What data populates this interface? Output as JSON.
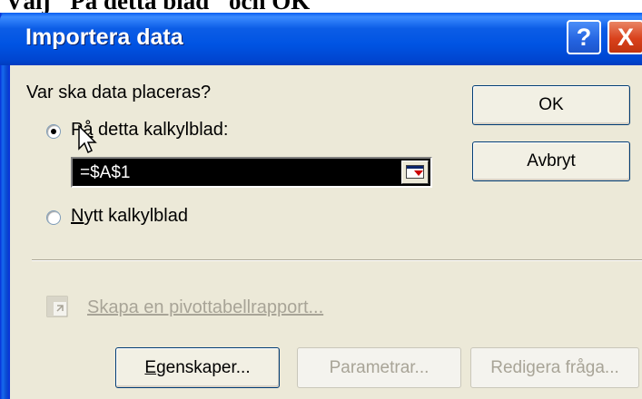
{
  "background": {
    "instruction_text": "Välj \"På detta blad\" och OK"
  },
  "dialog": {
    "title": "Importera data",
    "help_button": "?",
    "close_button": "X",
    "question": "Var ska data placeras?",
    "options": [
      {
        "label_prefix": "P",
        "label_underlined": "å",
        "label_rest": " detta kalkylblad:",
        "selected": true
      },
      {
        "label_prefix": "",
        "label_underlined": "N",
        "label_rest": "ytt kalkylblad",
        "selected": false
      }
    ],
    "reference_value": "=$A$1",
    "pivot_link": "Skapa en pivottabellrapport...",
    "buttons": {
      "ok": "OK",
      "cancel": "Avbryt",
      "properties": "Egenskaper...",
      "parameters": "Parametrar...",
      "edit_query": "Redigera fråga..."
    }
  },
  "colors": {
    "titlebar": "#0054e3",
    "dialog_bg": "#ece9d8",
    "disabled_text": "#a8a497"
  }
}
